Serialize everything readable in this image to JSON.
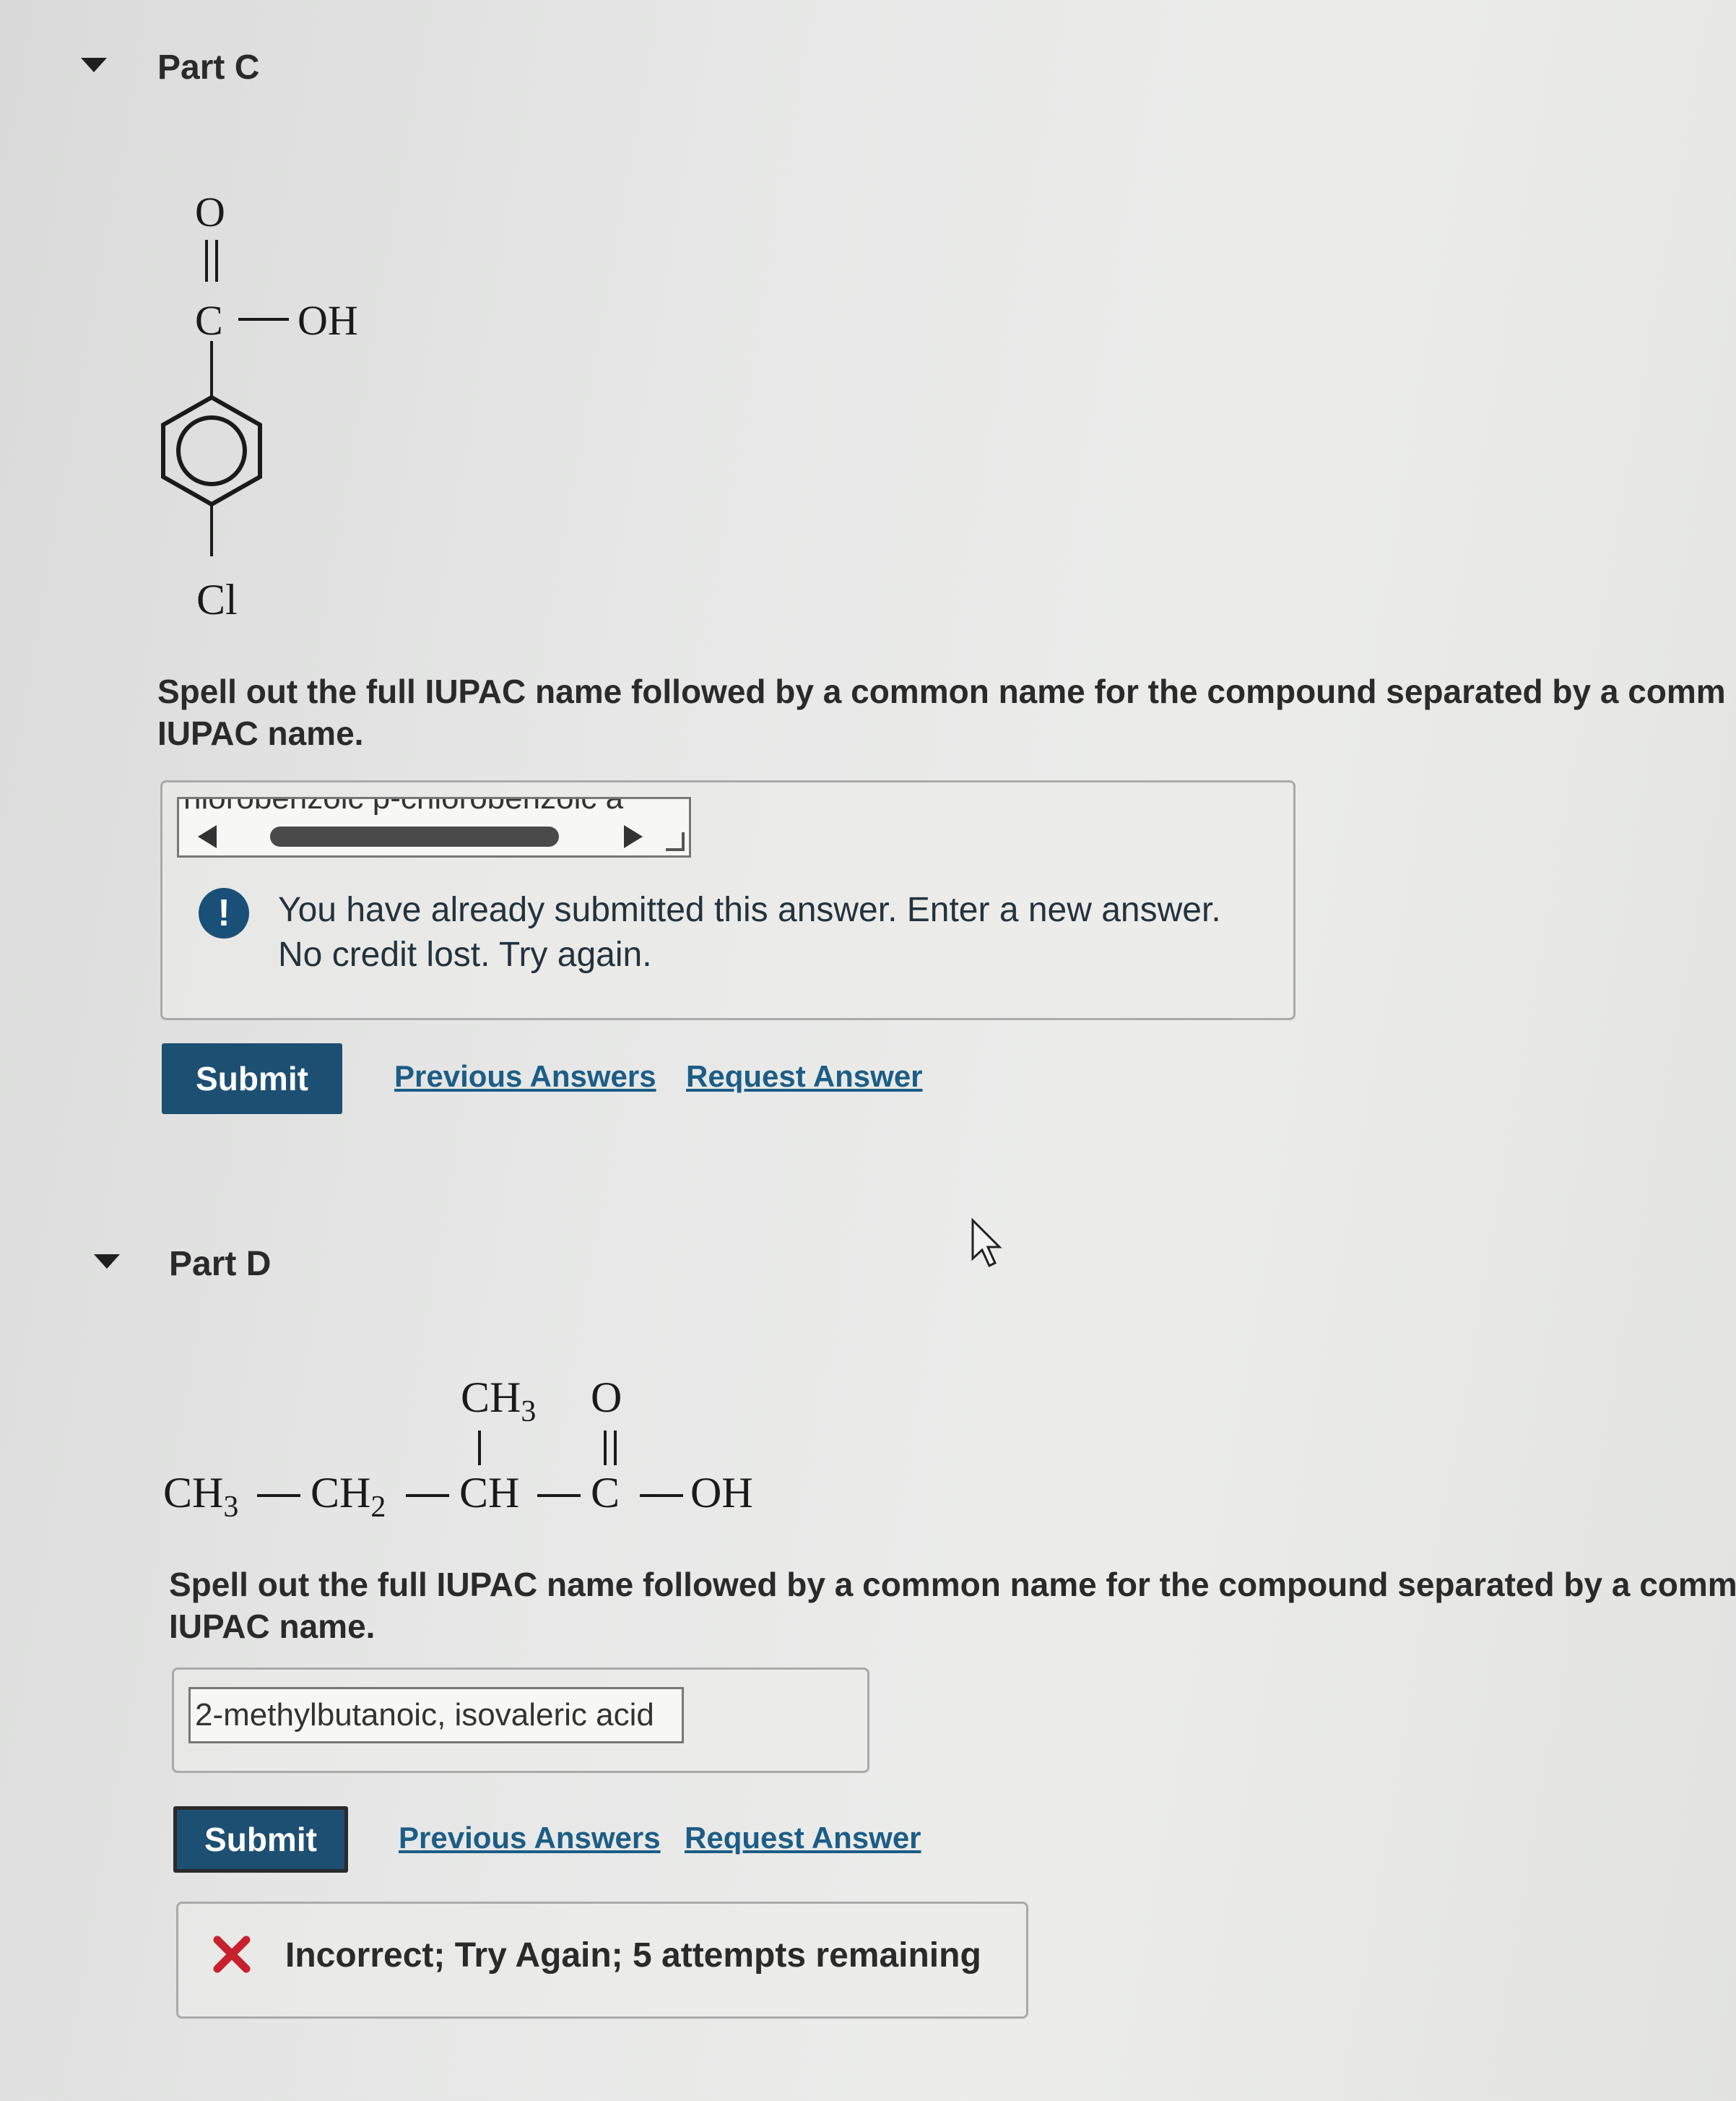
{
  "partC": {
    "title": "Part C",
    "structure": {
      "carbonyl_o": "O",
      "carbon": "C",
      "hydroxyl": "OH",
      "chlorine": "Cl"
    },
    "question_line1": "Spell out the full IUPAC name followed by a common name for the compound separated by a comm",
    "question_line2": "IUPAC name.",
    "answer_value": "hlorobenzoic p-chlorobenzoic a",
    "feedback_line1": "You have already submitted this answer. Enter a new answer.",
    "feedback_line2": "No credit lost. Try again.",
    "submit_label": "Submit",
    "previous_answers_label": "Previous Answers",
    "request_answer_label": "Request Answer"
  },
  "partD": {
    "title": "Part D",
    "structure": {
      "top_ch3": "CH3",
      "top_o": "O",
      "c1": "CH3",
      "c2": "CH2",
      "c3": "CH",
      "c4": "C",
      "oh": "OH"
    },
    "question_line1": "Spell out the full IUPAC name followed by a common name for the compound separated by a comma.",
    "question_line2": "IUPAC name.",
    "answer_value": "2-methylbutanoic, isovaleric acid",
    "submit_label": "Submit",
    "previous_answers_label": "Previous Answers",
    "request_answer_label": "Request Answer",
    "result_text": "Incorrect; Try Again; 5 attempts remaining"
  },
  "colors": {
    "accent": "#1d4f72",
    "link": "#1c5d86",
    "error": "#c8212e",
    "info": "#1a4f77"
  }
}
